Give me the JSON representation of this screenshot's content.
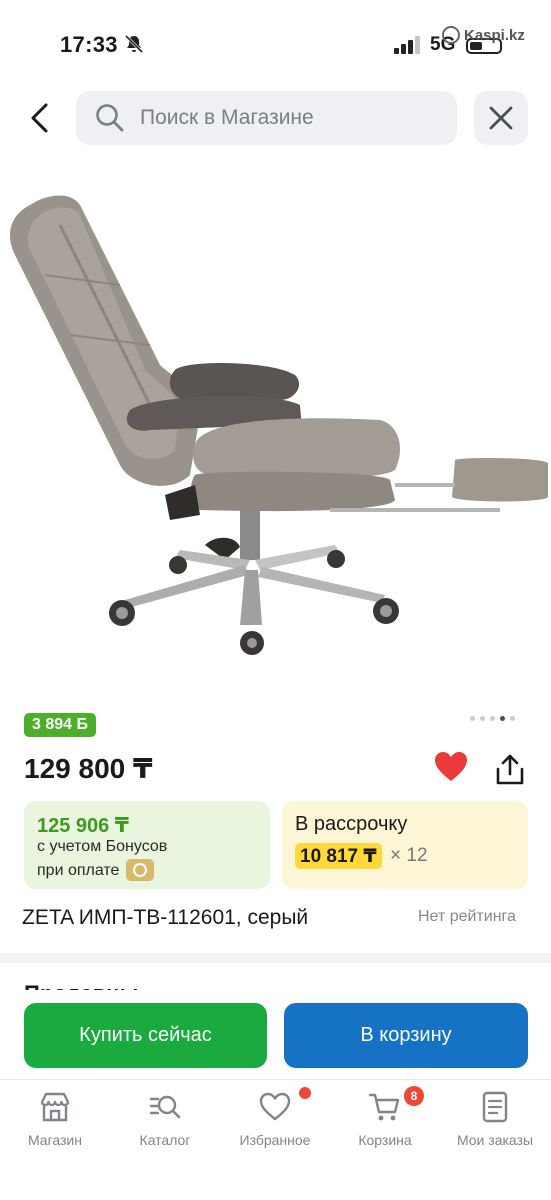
{
  "status_bar": {
    "time": "17:33",
    "network": "5G",
    "watermark": "Kaspi.kz"
  },
  "header": {
    "search_placeholder": "Поиск в Магазине"
  },
  "product": {
    "bonus_badge": "3 894 Б",
    "price": "129 800 ₸",
    "image_count": 5,
    "active_image_index": 3,
    "is_favorite": true,
    "bonus_offer": {
      "price": "125 906 ₸",
      "line1": "с учетом Бонусов",
      "line2": "при оплате"
    },
    "installment": {
      "title": "В рассрочку",
      "monthly": "10 817 ₸",
      "months": "× 12"
    },
    "title": "ZETA ИМП-ТВ-112601, серый",
    "rating": "Нет рейтинга"
  },
  "sellers": {
    "heading": "Продавцы"
  },
  "actions": {
    "buy_now": "Купить сейчас",
    "add_to_cart": "В корзину"
  },
  "tab_bar": {
    "tabs": [
      {
        "label": "Магазин",
        "icon": "shop-icon"
      },
      {
        "label": "Каталог",
        "icon": "catalog-search-icon"
      },
      {
        "label": "Избранное",
        "icon": "heart-outline-icon"
      },
      {
        "label": "Корзина",
        "icon": "cart-icon"
      },
      {
        "label": "Мои заказы",
        "icon": "orders-icon"
      }
    ],
    "cart_count": "8"
  },
  "colors": {
    "bonus_green": "#4caf2a",
    "buy_green": "#1aaa3f",
    "cart_blue": "#1672c4",
    "installment_yellow": "#ffd93a",
    "favorite_red": "#ea3a3a"
  }
}
